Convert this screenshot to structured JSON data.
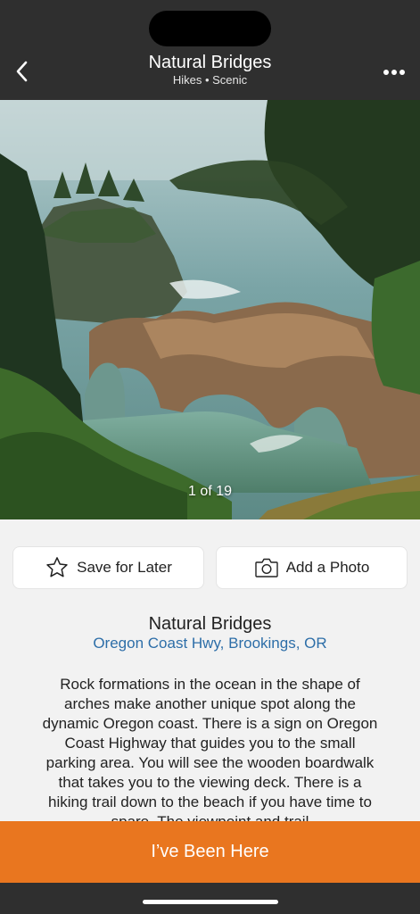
{
  "header": {
    "title": "Natural Bridges",
    "subtitle": "Hikes • Scenic",
    "back_icon": "chevron-left-icon",
    "more_icon": "ellipsis-horizontal-icon"
  },
  "photo": {
    "counter": "1 of 19",
    "current": 1,
    "total": 19
  },
  "actions": {
    "save_label": "Save for Later",
    "save_icon": "star-outline-icon",
    "photo_label": "Add a Photo",
    "photo_icon": "camera-icon"
  },
  "place": {
    "name": "Natural Bridges",
    "address": "Oregon Coast Hwy, Brookings, OR",
    "description": "Rock formations in the ocean in the shape of arches make another unique spot along the dynamic Oregon coast. There is a sign on Oregon Coast Highway that guides you to the small parking area. You will see the wooden boardwalk that takes you to the viewing deck. There is a hiking trail down to the beach if you have time to spare. The viewpoint and trail"
  },
  "cta": {
    "label": "I’ve Been Here"
  },
  "colors": {
    "header_bg": "#2f2f2f",
    "accent_orange": "#e9761f",
    "link_blue": "#2d6ea8",
    "page_bg": "#f2f2f2"
  }
}
